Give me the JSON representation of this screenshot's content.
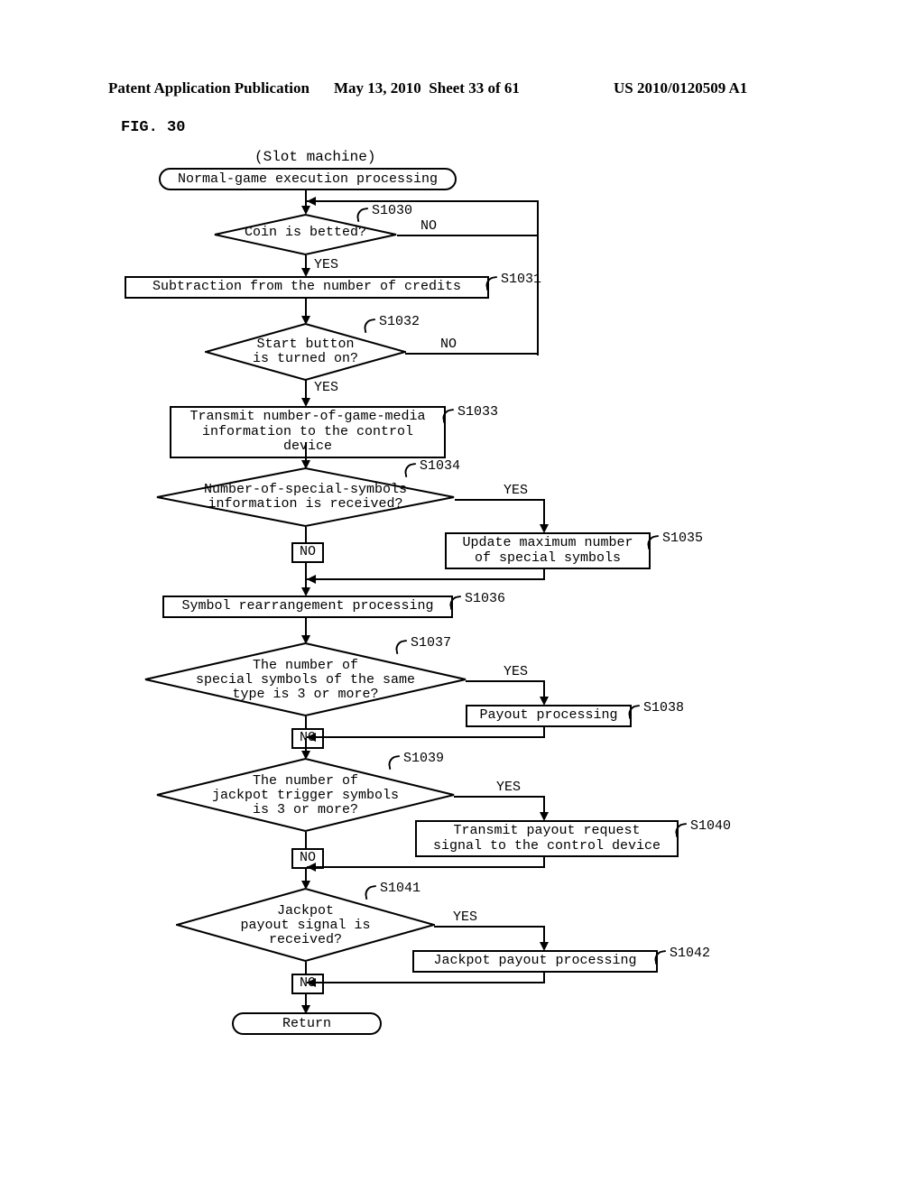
{
  "header": {
    "publication": "Patent Application Publication",
    "date": "May 13, 2010",
    "sheet": "Sheet 33 of 61",
    "docnum": "US 2010/0120509 A1"
  },
  "fig_label": "FIG. 30",
  "slot_machine": "(Slot machine)",
  "nodes": {
    "start": "Normal-game execution processing",
    "d1030": "Coin is betted?",
    "p1031": "Subtraction from the number of credits",
    "d1032": "Start button\nis turned on?",
    "p1033": "Transmit number-of-game-media\ninformation to the control device",
    "d1034": "Number-of-special-symbols\ninformation is received?",
    "p1035": "Update maximum number\nof special symbols",
    "p1036": "Symbol rearrangement processing",
    "d1037": "The number of\nspecial symbols of the same\ntype is 3 or more?",
    "p1038": "Payout processing",
    "d1039": "The number of\njackpot trigger symbols\nis 3 or more?",
    "p1040": "Transmit payout request\nsignal to the control device",
    "d1041": "Jackpot\npayout signal is\nreceived?",
    "p1042": "Jackpot payout processing",
    "ret": "Return"
  },
  "labels": {
    "yes": "YES",
    "no": "NO"
  },
  "refs": {
    "s1030": "S1030",
    "s1031": "S1031",
    "s1032": "S1032",
    "s1033": "S1033",
    "s1034": "S1034",
    "s1035": "S1035",
    "s1036": "S1036",
    "s1037": "S1037",
    "s1038": "S1038",
    "s1039": "S1039",
    "s1040": "S1040",
    "s1041": "S1041",
    "s1042": "S1042"
  }
}
